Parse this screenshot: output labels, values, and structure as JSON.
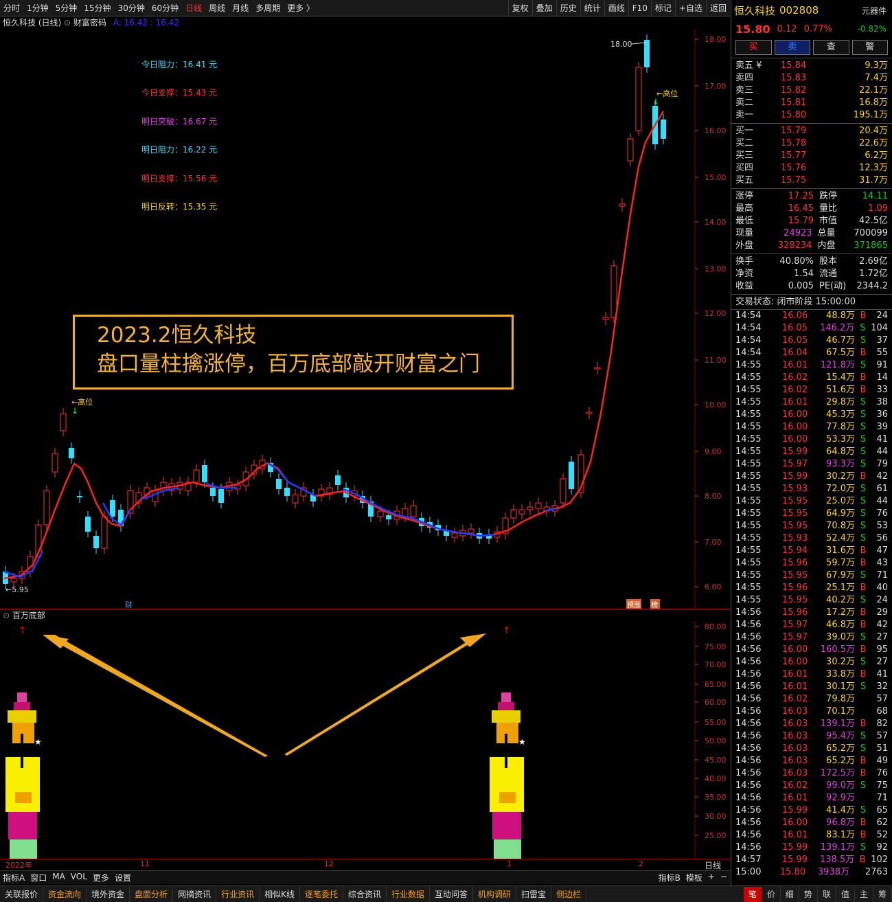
{
  "toolbar": {
    "periods": [
      "分时",
      "1分钟",
      "5分钟",
      "15分钟",
      "30分钟",
      "60分钟",
      "日线",
      "周线",
      "月线",
      "多周期",
      "更多 〉"
    ],
    "active": "日线",
    "right": [
      "复权",
      "叠加",
      "历史",
      "统计",
      "画线",
      "F10",
      "标记",
      "+自选",
      "返回"
    ]
  },
  "chart_title": {
    "name": "恒久科技 (日线)",
    "indicator": "财富密码",
    "a_label": "A: 16.42 : 16.42"
  },
  "levels": [
    {
      "label": "今日阻力：16.41 元",
      "color": "#33e0ff"
    },
    {
      "label": "今日支撑：15.43 元",
      "color": "#ff3232"
    },
    {
      "label": "明日突破：16.67 元",
      "color": "#e040e0"
    },
    {
      "label": "明日阻力：16.22 元",
      "color": "#33e0ff"
    },
    {
      "label": "明日支撑：15.56 元",
      "color": "#ff3232"
    },
    {
      "label": "明日反转：15.35 元",
      "color": "#ffd700"
    }
  ],
  "annotation": {
    "line1": "2023.2恒久科技",
    "line2": "盘口量柱擒涨停，百万底部敲开财富之门"
  },
  "price_axis": [
    "18.00",
    "17.00",
    "16.00",
    "15.00",
    "14.00",
    "13.00",
    "12.00",
    "11.00",
    "10.00",
    "9.00",
    "8.00",
    "7.00",
    "6.00"
  ],
  "chart_labels": {
    "high": "18.00",
    "low": "←5.95",
    "high_mark": "←高位",
    "high_mark2": "←高位",
    "cai": "财",
    "yz": "预涨",
    "bang": "榜"
  },
  "sub": {
    "title": "百万底部",
    "axis": [
      "80.00",
      "75.00",
      "70.00",
      "65.00",
      "60.00",
      "55.00",
      "50.00",
      "45.00",
      "40.00",
      "35.00",
      "30.00",
      "25.00"
    ]
  },
  "dates": [
    "2022年",
    "11",
    "12",
    "1",
    "2"
  ],
  "bottom1": {
    "left": [
      "指标A",
      "窗口",
      "MA",
      "VOL",
      "更多",
      "设置"
    ],
    "right": [
      "指标B",
      "模板",
      "+",
      "−"
    ],
    "period": "日线"
  },
  "bottom2": [
    "关联报价",
    "资金流向",
    "境外资金",
    "盘面分析",
    "网摘资讯",
    "行业资讯",
    "相似K线",
    "逐笔委托",
    "综合资讯",
    "行业数据",
    "互动问答",
    "机构调研",
    "扫雷宝",
    "侧边栏"
  ],
  "bottom2_right": [
    "笔",
    "价",
    "细",
    "势",
    "联",
    "值",
    "主",
    "筹"
  ],
  "quote": {
    "name": "恒久科技",
    "code": "002808",
    "tag": "元器件",
    "price": "15.80",
    "change": "0.12",
    "pct": "0.77%",
    "sector_pct": "-0.82%",
    "buttons": [
      "买",
      "卖",
      "查",
      "警"
    ],
    "asks": [
      [
        "卖五 ¥",
        "15.84",
        "9.3万"
      ],
      [
        "卖四",
        "15.83",
        "7.4万"
      ],
      [
        "卖三",
        "15.82",
        "22.1万"
      ],
      [
        "卖二",
        "15.81",
        "16.8万"
      ],
      [
        "卖一",
        "15.80",
        "195.1万"
      ]
    ],
    "bids": [
      [
        "买一",
        "15.79",
        "20.4万"
      ],
      [
        "买二",
        "15.78",
        "22.6万"
      ],
      [
        "买三",
        "15.77",
        "6.2万"
      ],
      [
        "买四",
        "15.76",
        "12.3万"
      ],
      [
        "买五",
        "15.75",
        "31.7万"
      ]
    ],
    "stats": [
      [
        "涨停",
        "17.25",
        "跌停",
        "14.11"
      ],
      [
        "最高",
        "16.45",
        "量比",
        "1.09"
      ],
      [
        "最低",
        "15.79",
        "市值",
        "42.5亿"
      ],
      [
        "现量",
        "24923",
        "总量",
        "700099"
      ],
      [
        "外盘",
        "328234",
        "内盘",
        "371865"
      ]
    ],
    "stats2": [
      [
        "换手",
        "40.80%",
        "股本",
        "2.69亿"
      ],
      [
        "净资",
        "1.54",
        "流通",
        "1.72亿"
      ],
      [
        "收益",
        "0.005",
        "PE(动)",
        "2344.2"
      ]
    ],
    "status": "交易状态: 闭市阶段 15:00:00"
  },
  "ticks": [
    [
      "14:54",
      "16.06",
      "48.8万",
      "B",
      "24"
    ],
    [
      "14:54",
      "16.05",
      "146.2万",
      "S",
      "104"
    ],
    [
      "14:54",
      "16.05",
      "46.7万",
      "S",
      "37"
    ],
    [
      "14:54",
      "16.04",
      "67.5万",
      "B",
      "55"
    ],
    [
      "14:55",
      "16.01",
      "121.8万",
      "S",
      "91"
    ],
    [
      "14:55",
      "16.02",
      "15.4万",
      "B",
      "14"
    ],
    [
      "14:55",
      "16.02",
      "51.6万",
      "B",
      "33"
    ],
    [
      "14:55",
      "16.01",
      "29.8万",
      "S",
      "38"
    ],
    [
      "14:55",
      "16.00",
      "45.3万",
      "S",
      "36"
    ],
    [
      "14:55",
      "16.00",
      "77.8万",
      "S",
      "39"
    ],
    [
      "14:55",
      "16.00",
      "53.3万",
      "S",
      "41"
    ],
    [
      "14:55",
      "15.99",
      "64.8万",
      "S",
      "44"
    ],
    [
      "14:55",
      "15.97",
      "93.3万",
      "S",
      "79"
    ],
    [
      "14:55",
      "15.99",
      "30.2万",
      "B",
      "42"
    ],
    [
      "14:55",
      "15.93",
      "72.0万",
      "S",
      "61"
    ],
    [
      "14:55",
      "15.95",
      "25.0万",
      "S",
      "44"
    ],
    [
      "14:55",
      "15.95",
      "64.9万",
      "S",
      "76"
    ],
    [
      "14:55",
      "15.95",
      "70.8万",
      "S",
      "53"
    ],
    [
      "14:55",
      "15.93",
      "52.4万",
      "S",
      "56"
    ],
    [
      "14:55",
      "15.94",
      "31.6万",
      "B",
      "47"
    ],
    [
      "14:55",
      "15.96",
      "59.7万",
      "B",
      "43"
    ],
    [
      "14:55",
      "15.95",
      "67.9万",
      "S",
      "71"
    ],
    [
      "14:55",
      "15.96",
      "25.1万",
      "B",
      "40"
    ],
    [
      "14:55",
      "15.95",
      "40.2万",
      "S",
      "24"
    ],
    [
      "14:56",
      "15.96",
      "17.2万",
      "B",
      "29"
    ],
    [
      "14:56",
      "15.97",
      "46.8万",
      "B",
      "42"
    ],
    [
      "14:56",
      "15.97",
      "39.0万",
      "S",
      "27"
    ],
    [
      "14:56",
      "16.00",
      "160.5万",
      "B",
      "95"
    ],
    [
      "14:56",
      "16.00",
      "30.2万",
      "S",
      "27"
    ],
    [
      "14:56",
      "16.01",
      "33.8万",
      "B",
      "41"
    ],
    [
      "14:56",
      "16.01",
      "30.1万",
      "S",
      "32"
    ],
    [
      "14:56",
      "16.02",
      "79.8万",
      "",
      "57"
    ],
    [
      "14:56",
      "16.03",
      "70.1万",
      "",
      "68"
    ],
    [
      "14:56",
      "16.03",
      "139.1万",
      "B",
      "82"
    ],
    [
      "14:56",
      "16.03",
      "95.4万",
      "S",
      "57"
    ],
    [
      "14:56",
      "16.03",
      "65.2万",
      "S",
      "51"
    ],
    [
      "14:56",
      "16.03",
      "65.2万",
      "B",
      "49"
    ],
    [
      "14:56",
      "16.03",
      "172.5万",
      "B",
      "76"
    ],
    [
      "14:56",
      "16.02",
      "99.0万",
      "S",
      "75"
    ],
    [
      "14:56",
      "16.01",
      "92.9万",
      "",
      "71"
    ],
    [
      "14:56",
      "15.99",
      "41.4万",
      "S",
      "65"
    ],
    [
      "14:56",
      "16.00",
      "96.8万",
      "B",
      "62"
    ],
    [
      "14:56",
      "16.01",
      "83.1万",
      "B",
      "52"
    ],
    [
      "14:56",
      "15.99",
      "139.1万",
      "S",
      "92"
    ],
    [
      "14:57",
      "15.99",
      "138.5万",
      "B",
      "102"
    ],
    [
      "15:00",
      "15.80",
      "3938万",
      "",
      "2763"
    ]
  ]
}
